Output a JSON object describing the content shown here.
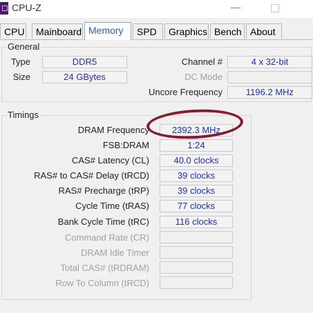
{
  "window": {
    "title": "CPU-Z"
  },
  "tabs": [
    "CPU",
    "Mainboard",
    "Memory",
    "SPD",
    "Graphics",
    "Bench",
    "About"
  ],
  "active_tab": "Memory",
  "general": {
    "title": "General",
    "type_label": "Type",
    "type_value": "DDR5",
    "size_label": "Size",
    "size_value": "24 GBytes",
    "channel_label": "Channel #",
    "channel_value": "4 x 32-bit",
    "dcmode_label": "DC Mode",
    "dcmode_value": "",
    "uncore_label": "Uncore Frequency",
    "uncore_value": "1196.2 MHz"
  },
  "timings": {
    "title": "Timings",
    "dram_freq_label": "DRAM Frequency",
    "dram_freq_value": "2392.3 MHz",
    "fsb_label": "FSB:DRAM",
    "fsb_value": "1:24",
    "cas_label": "CAS# Latency (CL)",
    "cas_value": "40.0 clocks",
    "trcd_label": "RAS# to CAS# Delay (tRCD)",
    "trcd_value": "39 clocks",
    "trp_label": "RAS# Precharge (tRP)",
    "trp_value": "39 clocks",
    "tras_label": "Cycle Time (tRAS)",
    "tras_value": "77 clocks",
    "trc_label": "Bank Cycle Time (tRC)",
    "trc_value": "116 clocks",
    "cr_label": "Command Rate (CR)",
    "cr_value": "",
    "idle_label": "DRAM Idle Timer",
    "idle_value": "",
    "trdram_label": "Total CAS# (tRDRAM)",
    "trdram_value": "",
    "rtc_label": "Row To Column (tRCD)",
    "rtc_value": ""
  },
  "colors": {
    "value_text": "#1c2ed3",
    "annotation_circle": "#8b1a2a",
    "active_tab_text": "#2b59c3"
  }
}
